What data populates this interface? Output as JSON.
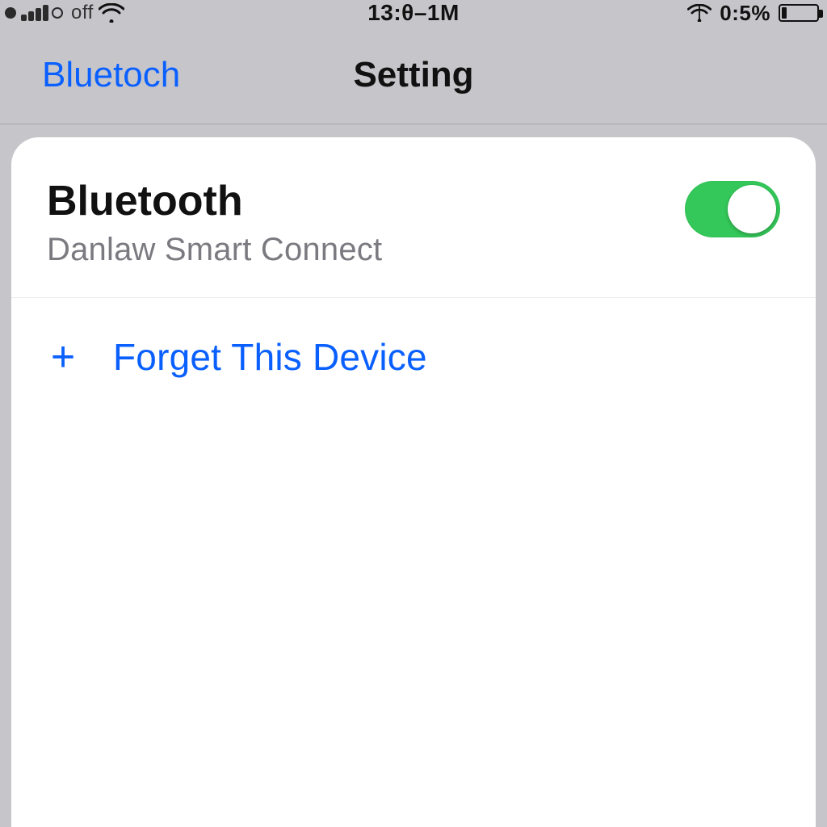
{
  "status_bar": {
    "carrier_text": "off",
    "time": "13:θ–1M",
    "battery_text": "0:5%"
  },
  "nav": {
    "back_label": "Bluetoch",
    "title": "Setting"
  },
  "card": {
    "section_title": "Bluetooth",
    "device_name": "Danlaw Smart Connect",
    "toggle_on": true,
    "forget_label": "Forget This Device"
  },
  "colors": {
    "link_blue": "#0a60ff",
    "toggle_green": "#34c759",
    "bg_gray": "#c6c6ca"
  }
}
